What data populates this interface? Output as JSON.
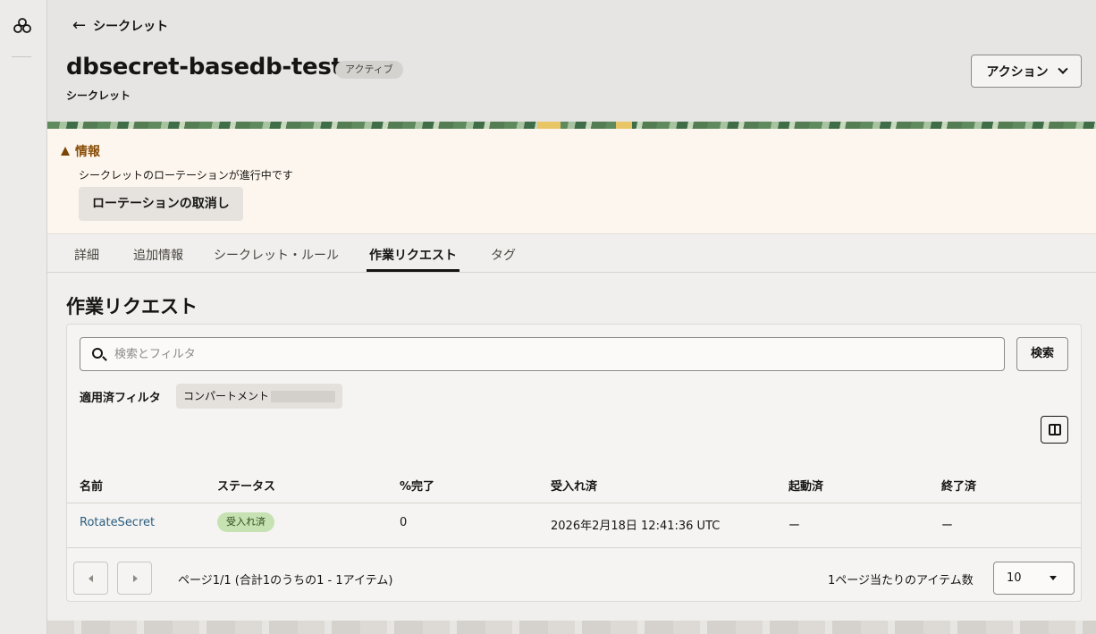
{
  "header": {
    "back_label": "シークレット",
    "title": "dbsecret-basedb-test",
    "status": "アクティブ",
    "subtitle": "シークレット",
    "actions_label": "アクション"
  },
  "info": {
    "heading": "情報",
    "message": "シークレットのローテーションが進行中です",
    "cancel_label": "ローテーションの取消し"
  },
  "tabs": [
    "詳細",
    "追加情報",
    "シークレット・ルール",
    "作業リクエスト",
    "タグ"
  ],
  "active_tab": "作業リクエスト",
  "section": {
    "title": "作業リクエスト",
    "search_placeholder": "検索とフィルタ",
    "search_button": "検索",
    "filter_label": "適用済フィルタ",
    "filter_chip": "コンパートメント"
  },
  "table": {
    "headers": [
      "名前",
      "ステータス",
      "%完了",
      "受入れ済",
      "起動済",
      "終了済"
    ],
    "rows": [
      {
        "name": "RotateSecret",
        "status": "受入れ済",
        "percent": "0",
        "accepted": "2026年2月18日 12:41:36 UTC",
        "started": "ー",
        "finished": "ー"
      }
    ]
  },
  "pagination": {
    "info": "ページ1/1 (合計1のうちの1 - 1アイテム)",
    "per_page_label": "1ページ当たりのアイテム数",
    "per_page_value": "10"
  },
  "colors": {
    "link": "#2b5d7e",
    "status_badge_bg": "#c6e2b3",
    "info_bg": "#fdf6ee",
    "info_text": "#8a4f09"
  }
}
